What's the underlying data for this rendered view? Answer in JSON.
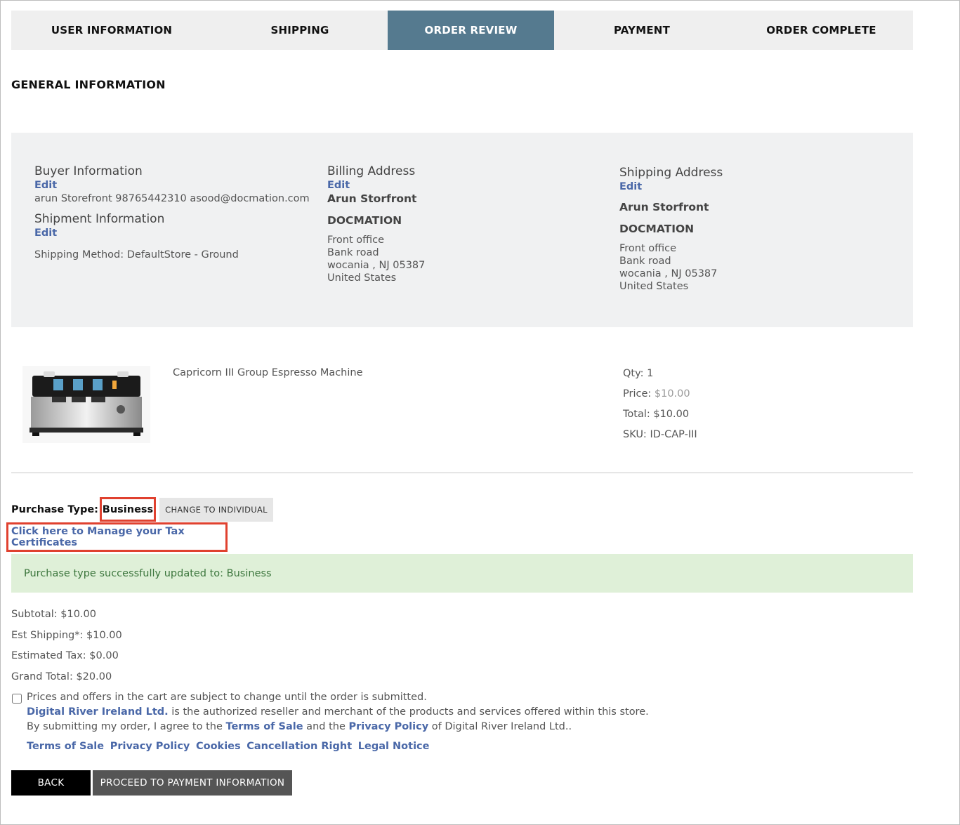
{
  "steps": [
    {
      "label": "USER INFORMATION",
      "active": false
    },
    {
      "label": "SHIPPING",
      "active": false
    },
    {
      "label": "ORDER REVIEW",
      "active": true
    },
    {
      "label": "PAYMENT",
      "active": false
    },
    {
      "label": "ORDER COMPLETE",
      "active": false
    }
  ],
  "section_title": "GENERAL INFORMATION",
  "buyer": {
    "heading": "Buyer Information",
    "edit_label": "Edit",
    "details": "arun Storefront 98765442310 asood@docmation.com"
  },
  "shipment": {
    "heading": "Shipment Information",
    "edit_label": "Edit",
    "method": "Shipping Method:  DefaultStore - Ground"
  },
  "billing": {
    "heading": "Billing Address",
    "edit_label": "Edit",
    "name": "Arun  Storfront",
    "company": "DOCMATION",
    "line1": "Front office",
    "line2": "Bank road",
    "city_line": "wocania , NJ  05387",
    "country": "United States"
  },
  "shipping_address": {
    "heading": "Shipping Address",
    "edit_label": "Edit",
    "name": "Arun  Storfront",
    "company": "DOCMATION",
    "line1": "Front office",
    "line2": "Bank road",
    "city_line": "wocania , NJ  05387",
    "country": "United States"
  },
  "product": {
    "name": "Capricorn III Group Espresso Machine",
    "qty_label": "Qty:",
    "qty": "1",
    "price_label": "Price:",
    "price": "$10.00",
    "total_label": "Total:",
    "total": "$10.00",
    "sku_label": "SKU:",
    "sku": "ID-CAP-III"
  },
  "purchase_type": {
    "label": "Purchase Type:",
    "value": "Business",
    "change_button": "CHANGE TO INDIVIDUAL",
    "tax_link": "Click here to Manage your Tax Certificates",
    "success_message": "Purchase type successfully updated to: Business"
  },
  "totals": {
    "subtotal": "Subtotal:  $10.00",
    "shipping": "Est Shipping*:  $10.00",
    "tax": "Estimated Tax:  $0.00",
    "grand": "Grand Total:  $20.00"
  },
  "terms": {
    "line1": "Prices and offers in the cart are subject to change until the order is submitted.",
    "reseller_link": "Digital River Ireland Ltd.",
    "line2_rest": " is the authorized reseller and merchant of the products and services offered within this store.",
    "line3_a": "By submitting my order, I agree to the ",
    "terms_link": "Terms of Sale",
    "line3_b": " and the ",
    "privacy_link": "Privacy Policy",
    "line3_c": " of Digital River Ireland Ltd.."
  },
  "footer_links": [
    "Terms of Sale",
    "Privacy Policy",
    "Cookies",
    "Cancellation Right",
    "Legal Notice"
  ],
  "buttons": {
    "back": "BACK",
    "proceed": "PROCEED TO PAYMENT INFORMATION"
  },
  "colors": {
    "active_step": "#557a8f",
    "link": "#4a68a8",
    "highlight_border": "#e0412f",
    "success_bg": "#dff0d8"
  }
}
